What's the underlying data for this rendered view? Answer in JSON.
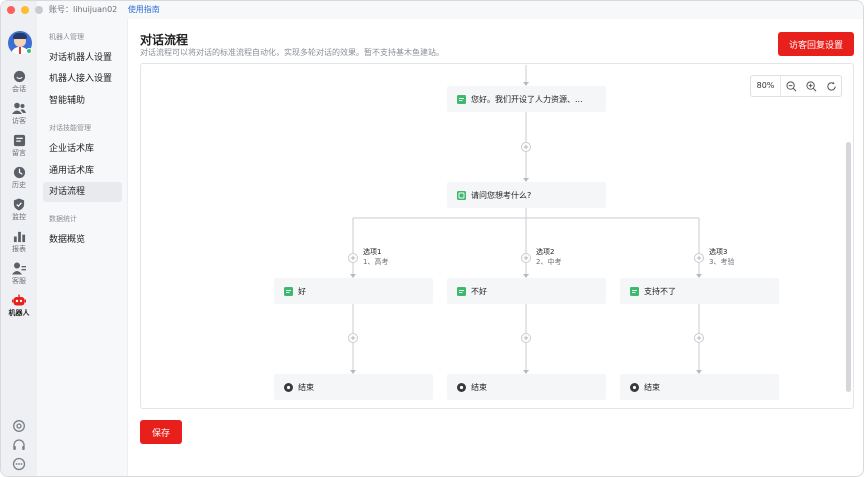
{
  "window": {
    "traffic_colors": [
      "#fe5f57",
      "#febc2e",
      "#28c840"
    ]
  },
  "topbar": {
    "account_label": "账号：lihuijuan02",
    "guide_link": "使用指南"
  },
  "rail": {
    "items": [
      {
        "label": "会话",
        "icon": "chat-icon"
      },
      {
        "label": "访客",
        "icon": "visitor-icon"
      },
      {
        "label": "留言",
        "icon": "message-icon"
      },
      {
        "label": "历史",
        "icon": "history-icon"
      },
      {
        "label": "监控",
        "icon": "monitor-shield-icon"
      },
      {
        "label": "报表",
        "icon": "report-bar-icon"
      },
      {
        "label": "客服",
        "icon": "agent-icon"
      },
      {
        "label": "机器人",
        "icon": "robot-icon"
      }
    ],
    "active_index": 7,
    "bottom_icons": [
      "settings-icon",
      "headset-icon",
      "more-icon"
    ],
    "accent_color": "#e8201c"
  },
  "subnav": {
    "groups": [
      {
        "title": "机器人管理",
        "items": [
          "对话机器人设置",
          "机器人接入设置",
          "智能辅助"
        ]
      },
      {
        "title": "对话技能管理",
        "items": [
          "企业话术库",
          "通用话术库",
          "对话流程"
        ]
      },
      {
        "title": "数据统计",
        "items": [
          "数据概览"
        ]
      }
    ],
    "active_item": "对话流程"
  },
  "page": {
    "title": "对话流程",
    "description": "对话流程可以将对话的标准流程自动化，实现多轮对话的效果。暂不支持基木鱼建站。",
    "visitor_reply_button": "访客回复设置",
    "save_button": "保存",
    "zoom_level": "80%"
  },
  "flow": {
    "greeting_node": "您好。我们开设了人力资源、...",
    "question_node": "请问您想考什么?",
    "options": [
      {
        "name": "选项1",
        "value": "1、高考",
        "reply": "好",
        "end": "结束"
      },
      {
        "name": "选项2",
        "value": "2、中考",
        "reply": "不好",
        "end": "结束"
      },
      {
        "name": "选项3",
        "value": "3、考验",
        "reply": "支持不了",
        "end": "结束"
      }
    ],
    "colors": {
      "message_icon": "#3cb96d",
      "end_icon": "#3a3a3a",
      "connector": "#c8cbd0"
    }
  }
}
